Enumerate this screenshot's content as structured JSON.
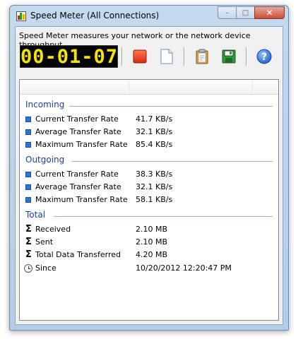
{
  "window": {
    "title": "Speed Meter (All Connections)",
    "caption_buttons": {
      "minimize": "–",
      "maximize": "□",
      "close": "✕"
    }
  },
  "description": "Speed Meter measures your network or the network device throughput",
  "timer": "00-01-07",
  "toolbar": [
    {
      "name": "stop-button",
      "icon": "stop-icon"
    },
    {
      "name": "new-button",
      "icon": "new-document-icon"
    },
    {
      "name": "copy-button",
      "icon": "clipboard-icon"
    },
    {
      "name": "save-button",
      "icon": "floppy-disk-icon"
    },
    {
      "name": "help-button",
      "icon": "help-icon"
    }
  ],
  "groups": {
    "incoming": {
      "title": "Incoming",
      "rows": [
        {
          "label": "Current Transfer Rate",
          "value": "41.7 KB/s"
        },
        {
          "label": "Average Transfer Rate",
          "value": "32.1 KB/s"
        },
        {
          "label": "Maximum Transfer Rate",
          "value": "85.4 KB/s"
        }
      ]
    },
    "outgoing": {
      "title": "Outgoing",
      "rows": [
        {
          "label": "Current Transfer Rate",
          "value": "38.3 KB/s"
        },
        {
          "label": "Average Transfer Rate",
          "value": "32.1 KB/s"
        },
        {
          "label": "Maximum Transfer Rate",
          "value": "58.1 KB/s"
        }
      ]
    },
    "total": {
      "title": "Total",
      "rows": [
        {
          "label": "Received",
          "value": "2.10 MB"
        },
        {
          "label": "Sent",
          "value": "2.10 MB"
        },
        {
          "label": "Total Data Transferred",
          "value": "4.20 MB"
        },
        {
          "label": "Since",
          "value": "10/20/2012 12:20:47 PM"
        }
      ]
    }
  },
  "colors": {
    "group_title": "#1e3ea0",
    "bullet": "#2e74d6",
    "led_text": "#f6e300",
    "led_bg": "#050505"
  }
}
